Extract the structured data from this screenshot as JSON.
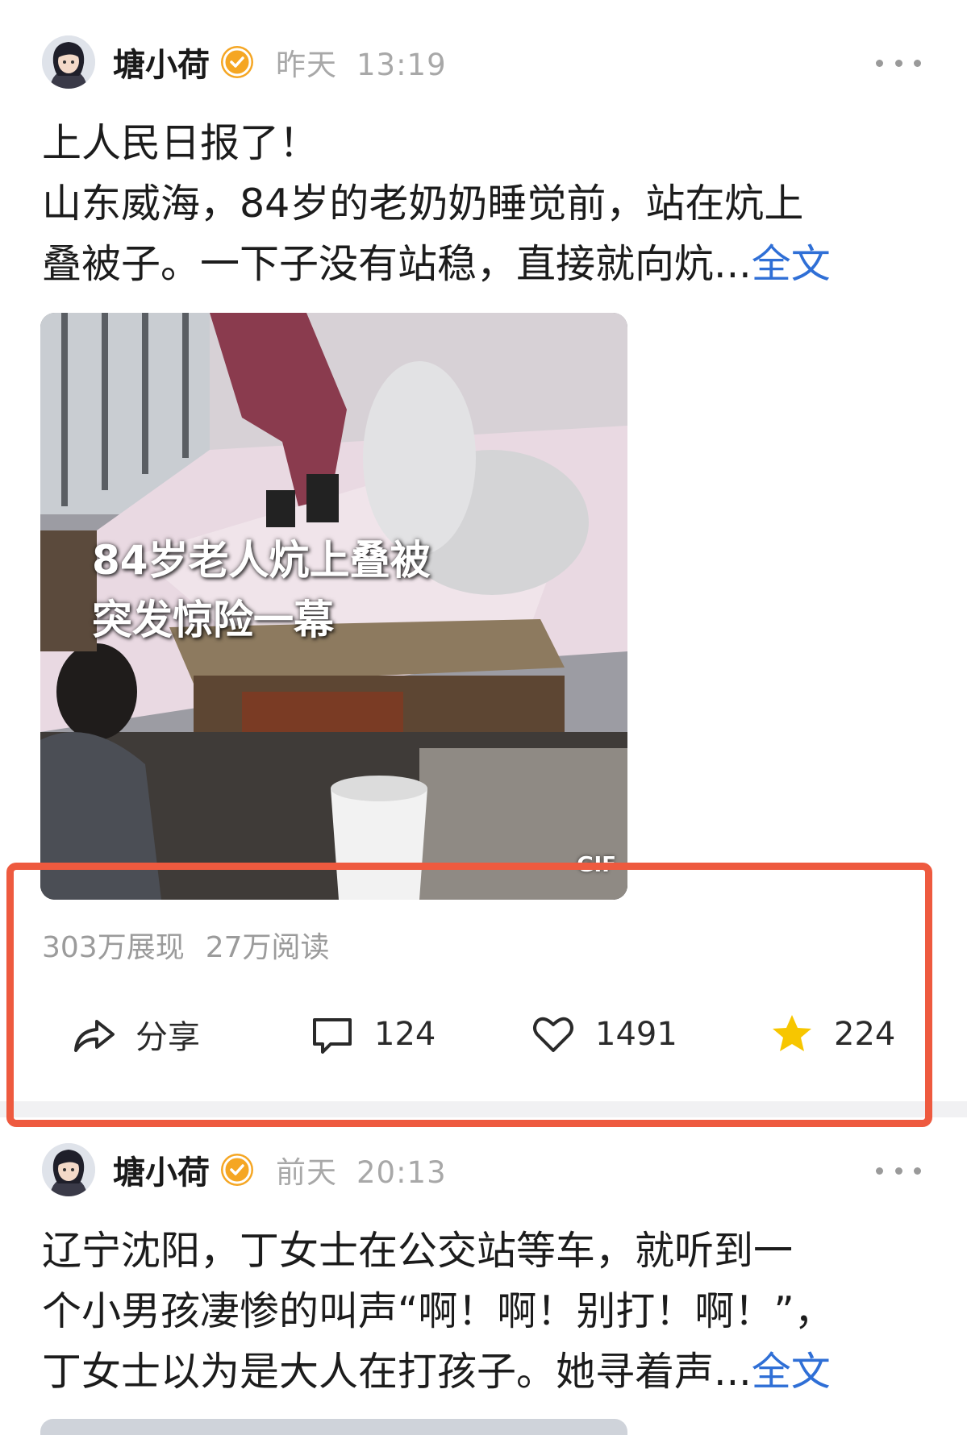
{
  "posts": [
    {
      "author": "塘小荷",
      "time_day": "昨天",
      "time_clock": "13:19",
      "text_lines": [
        "上人民日报了！",
        "山东威海，84岁的老奶奶睡觉前，站在炕上",
        "叠被子。一下子没有站稳，直接就向炕..."
      ],
      "full_link": "全文",
      "media": {
        "overlay_line1": "84岁老人炕上叠被",
        "overlay_line2": "突发惊险一幕",
        "gif_tag": "GIF"
      },
      "stats": {
        "impressions": "303万展现",
        "reads": "27万阅读"
      },
      "actions": {
        "share_label": "分享",
        "comments": "124",
        "likes": "1491",
        "favorites": "224"
      }
    },
    {
      "author": "塘小荷",
      "time_day": "前天",
      "time_clock": "20:13",
      "text_lines": [
        "辽宁沈阳，丁女士在公交站等车，就听到一",
        "个小男孩凄惨的叫声“啊！啊！别打！啊！”，",
        "丁女士以为是大人在打孩子。她寻着声..."
      ],
      "full_link": "全文"
    }
  ],
  "colors": {
    "link": "#2f6fd6",
    "highlight_border": "#ee5a3f",
    "verified_badge": "#f5a623",
    "favorite_star": "#f7c600",
    "muted_text": "#9b9b9b"
  },
  "icons": [
    "avatar",
    "verified-icon",
    "more-icon",
    "share-icon",
    "comment-icon",
    "heart-icon",
    "star-icon"
  ]
}
